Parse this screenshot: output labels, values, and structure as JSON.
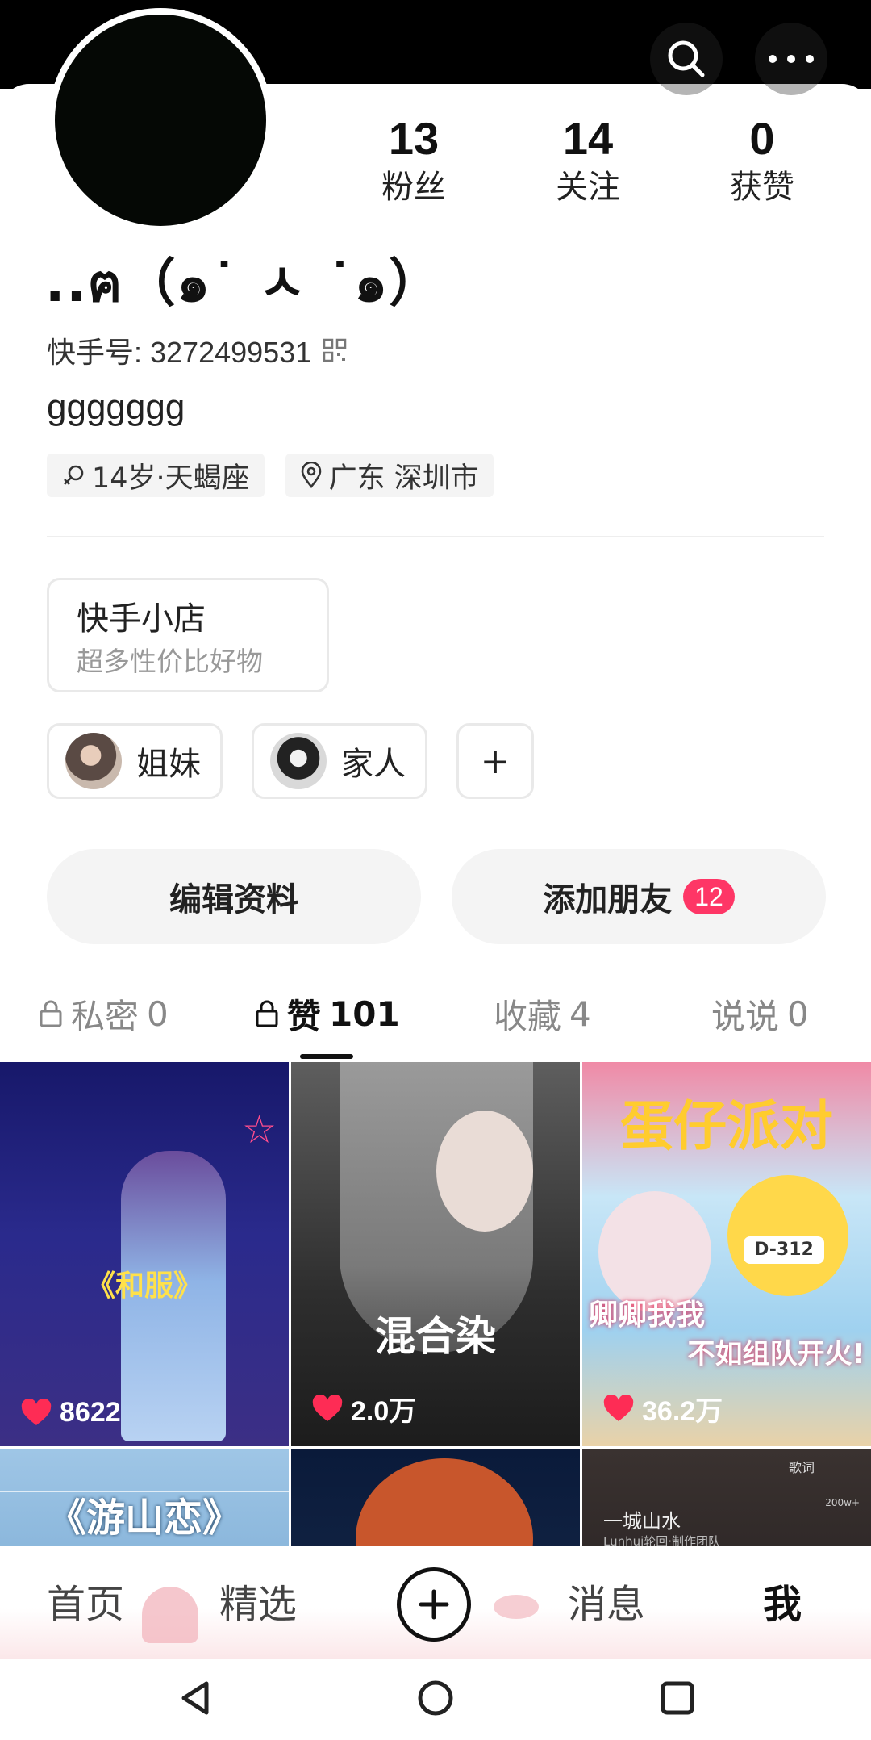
{
  "profile": {
    "name": "..ฅ（๑˙ ㅅ ˙๑）",
    "uid_label": "快手号: 3272499531",
    "bio": "ggggggg",
    "age_tag": "14岁·天蝎座",
    "location_tag": "广东 深圳市"
  },
  "stats": [
    {
      "value": "13",
      "label": "粉丝"
    },
    {
      "value": "14",
      "label": "关注"
    },
    {
      "value": "0",
      "label": "获赞"
    }
  ],
  "shop": {
    "title": "快手小店",
    "subtitle": "超多性价比好物"
  },
  "groups": [
    {
      "label": "姐妹"
    },
    {
      "label": "家人"
    }
  ],
  "group_add_label": "+",
  "actions": {
    "edit_label": "编辑资料",
    "add_friend_label": "添加朋友",
    "add_friend_badge": "12"
  },
  "tabs": [
    {
      "label": "私密",
      "count": "0",
      "locked": true,
      "active": false
    },
    {
      "label": "赞",
      "count": "101",
      "locked": true,
      "active": true
    },
    {
      "label": "收藏",
      "count": "4",
      "locked": false,
      "active": false
    },
    {
      "label": "说说",
      "count": "0",
      "locked": false,
      "active": false
    }
  ],
  "videos": [
    {
      "caption": "《和服》",
      "likes": "8622"
    },
    {
      "caption": "混合染",
      "likes": "2.0万"
    },
    {
      "caption": "蛋仔派对",
      "caption2": "卿卿我我",
      "caption3": "不如组队开火!",
      "badge": "D-312",
      "likes": "36.2万"
    },
    {
      "caption": "《游山恋》"
    },
    {
      "caption": ""
    },
    {
      "caption": "一城山水",
      "credit": "Lunhui轮回·制作团队",
      "lyric_tab": "歌词",
      "count": "200w+"
    }
  ],
  "bottom_nav": {
    "home": "首页",
    "featured": "精选",
    "messages": "消息",
    "me": "我"
  },
  "colors": {
    "accent": "#fe3666",
    "text": "#222222",
    "muted": "#999999"
  }
}
